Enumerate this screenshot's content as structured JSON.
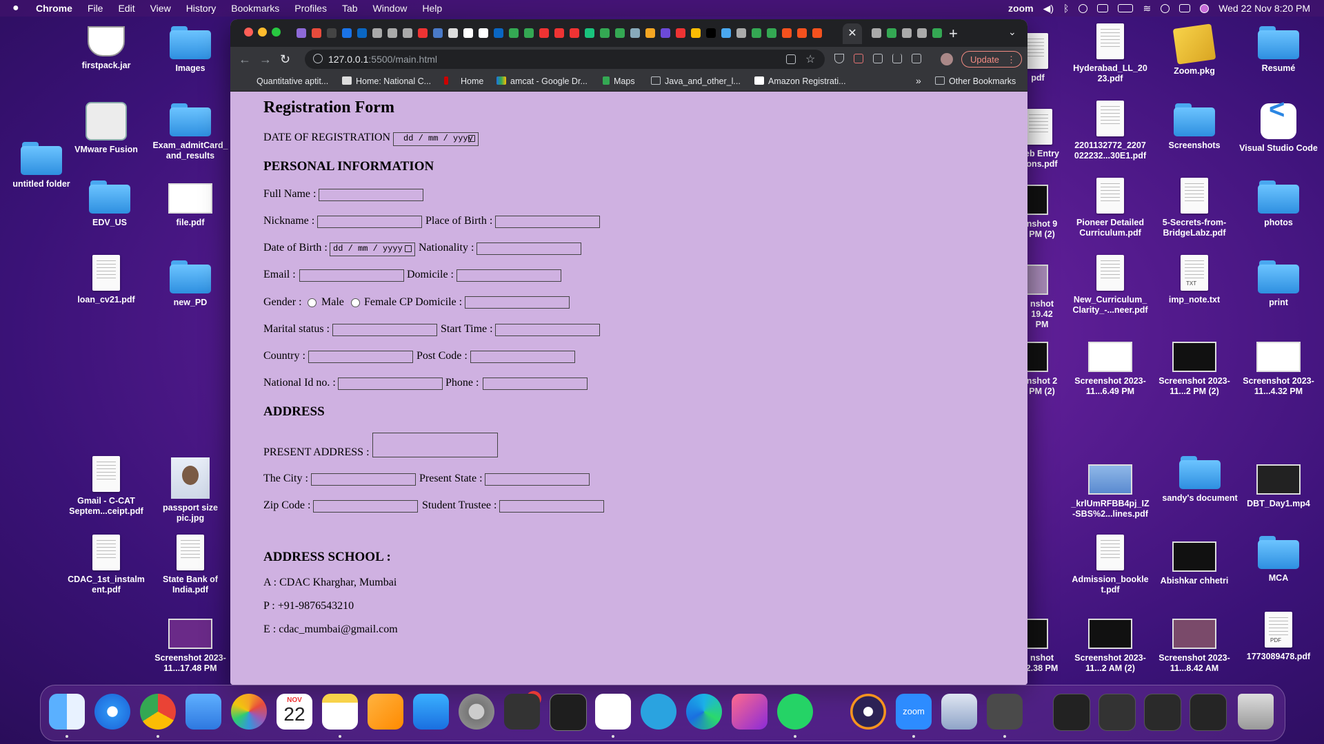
{
  "menubar": {
    "app": "Chrome",
    "items": [
      "File",
      "Edit",
      "View",
      "History",
      "Bookmarks",
      "Profiles",
      "Tab",
      "Window",
      "Help"
    ],
    "zoom": "zoom",
    "clock": "Wed 22 Nov  8:20 PM"
  },
  "desktop": {
    "left": [
      "firstpack.jar",
      "Images",
      "VMware Fusion",
      "Exam_admitCard_ and_results",
      "untitled folder",
      "EDV_US",
      "file.pdf",
      "loan_cv21.pdf",
      "new_PD",
      "Gmail - C-CAT Septem...ceipt.pdf",
      "passport size pic.jpg",
      "CDAC_1st_instalm ent.pdf",
      "State Bank of India.pdf",
      "Screenshot 2023-11...17.48 PM"
    ],
    "right": [
      "pdf",
      "Hyderabad_LL_20 23.pdf",
      "Zoom.pkg",
      "Resumé",
      "eb Entry ons.pdf",
      "2201132772_2207 022232...30E1.pdf",
      "Screenshots",
      "Visual Studio Code",
      "nshot 9 PM (2)",
      "Pioneer Detailed Curriculum.pdf",
      "5-Secrets-from- BridgeLabz.pdf",
      "photos",
      "nshot 19.42 PM",
      "New_Curriculum_ Clarity_-...neer.pdf",
      "imp_note.txt",
      "print",
      "nshot 2 PM (2)",
      "Screenshot 2023-11...6.49 PM",
      "Screenshot 2023-11...2 PM (2)",
      "Screenshot 2023-11...4.32 PM",
      "_krlUmRFBB4pj_IZ -SBS%2...lines.pdf",
      "sandy's document",
      "DBT_Day1.mp4",
      "Admission_bookle t.pdf",
      "Abishkar chhetri",
      "MCA",
      "nshot 2.38 PM",
      "Screenshot 2023-11...2 AM (2)",
      "Screenshot 2023-11...8.42 AM",
      "1773089478.pdf"
    ],
    "txt_label": "TXT",
    "pdf_label": "PDF"
  },
  "browser": {
    "url_host": "127.0.0.1",
    "url_path": ":5500/main.html",
    "update": "Update",
    "bookmarks": [
      "Quantitative aptit...",
      "Home: National C...",
      "Home",
      "amcat - Google Dr...",
      "Maps",
      "Java_and_other_l...",
      "Amazon Registrati...",
      "»",
      "Other Bookmarks"
    ]
  },
  "form": {
    "title": "Registration Form",
    "date_reg_label": "DATE OF REGISTRATION",
    "date_placeholder": "dd / mm / yyyy",
    "personal_heading": "PERSONAL INFORMATION",
    "full_name": "Full Name :",
    "nickname": "Nickname :",
    "place_of_birth": "Place of Birth :",
    "dob": "Date of Birth :",
    "nationality": "Nationality :",
    "email": "Email :",
    "domicile": "Domicile :",
    "gender": "Gender :",
    "male": "Male",
    "female_cp_domicile": "Female CP Domicile :",
    "marital": "Marital status :",
    "start_time": "Start Time :",
    "country": "Country :",
    "post_code": "Post Code :",
    "national_id": "National Id no. :",
    "phone": "Phone :",
    "address_heading": "ADDRESS",
    "present_address": "PRESENT ADDRESS :",
    "city": "The City :",
    "present_state": "Present State :",
    "zip": "Zip Code :",
    "student_trustee": "Student Trustee :",
    "school_heading": "ADDRESS SCHOOL :",
    "school_a": "A : CDAC Kharghar, Mumbai",
    "school_p": "P : +91-9876543210",
    "school_e": "E : cdac_mumbai@gmail.com"
  },
  "dock": {
    "cal_month": "NOV",
    "cal_day": "22",
    "settings_badge": "2",
    "zoom_label": "zoom"
  },
  "colors": {
    "page_bg": "#cfb1e1",
    "desktop_bg": "#5a1d93"
  }
}
